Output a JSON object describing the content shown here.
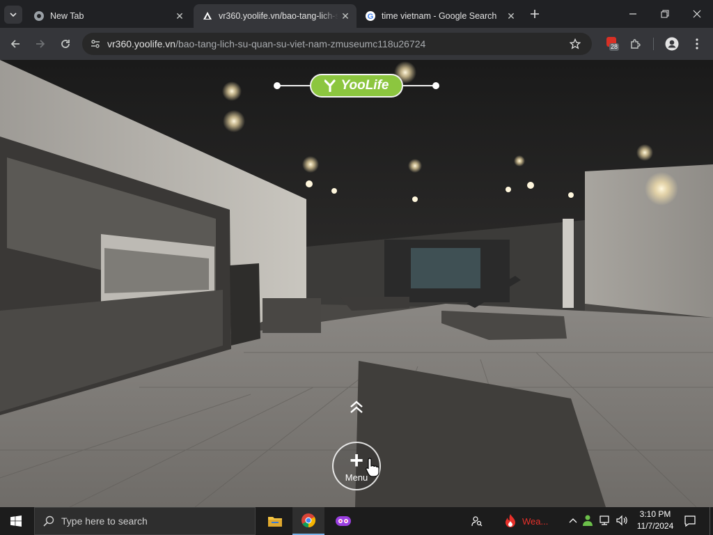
{
  "browser": {
    "tabs": [
      {
        "label": "New Tab",
        "icon": "chrome-icon"
      },
      {
        "label": "vr360.yoolife.vn/bao-tang-lich-su-quan-su-viet-nam-zmuseumc118u26724",
        "icon": "vr360-icon",
        "active": true
      },
      {
        "label": "time vietnam - Google Search",
        "icon": "google-icon"
      }
    ],
    "address_host": "vr360.yoolife.vn",
    "address_path": "/bao-tang-lich-su-quan-su-viet-nam-zmuseumc118u26724",
    "extension_badge": "28"
  },
  "tour": {
    "logo_text": "YooLife",
    "menu_label": "Menu"
  },
  "taskbar": {
    "search_placeholder": "Type here to search",
    "weather_label": "Wea...",
    "time": "3:10 PM",
    "date": "11/7/2024"
  },
  "colors": {
    "chrome_dark": "#202124",
    "chrome_toolbar": "#35363a",
    "yoolife_green": "#8cc63f",
    "taskbar": "#1c1c1c"
  }
}
